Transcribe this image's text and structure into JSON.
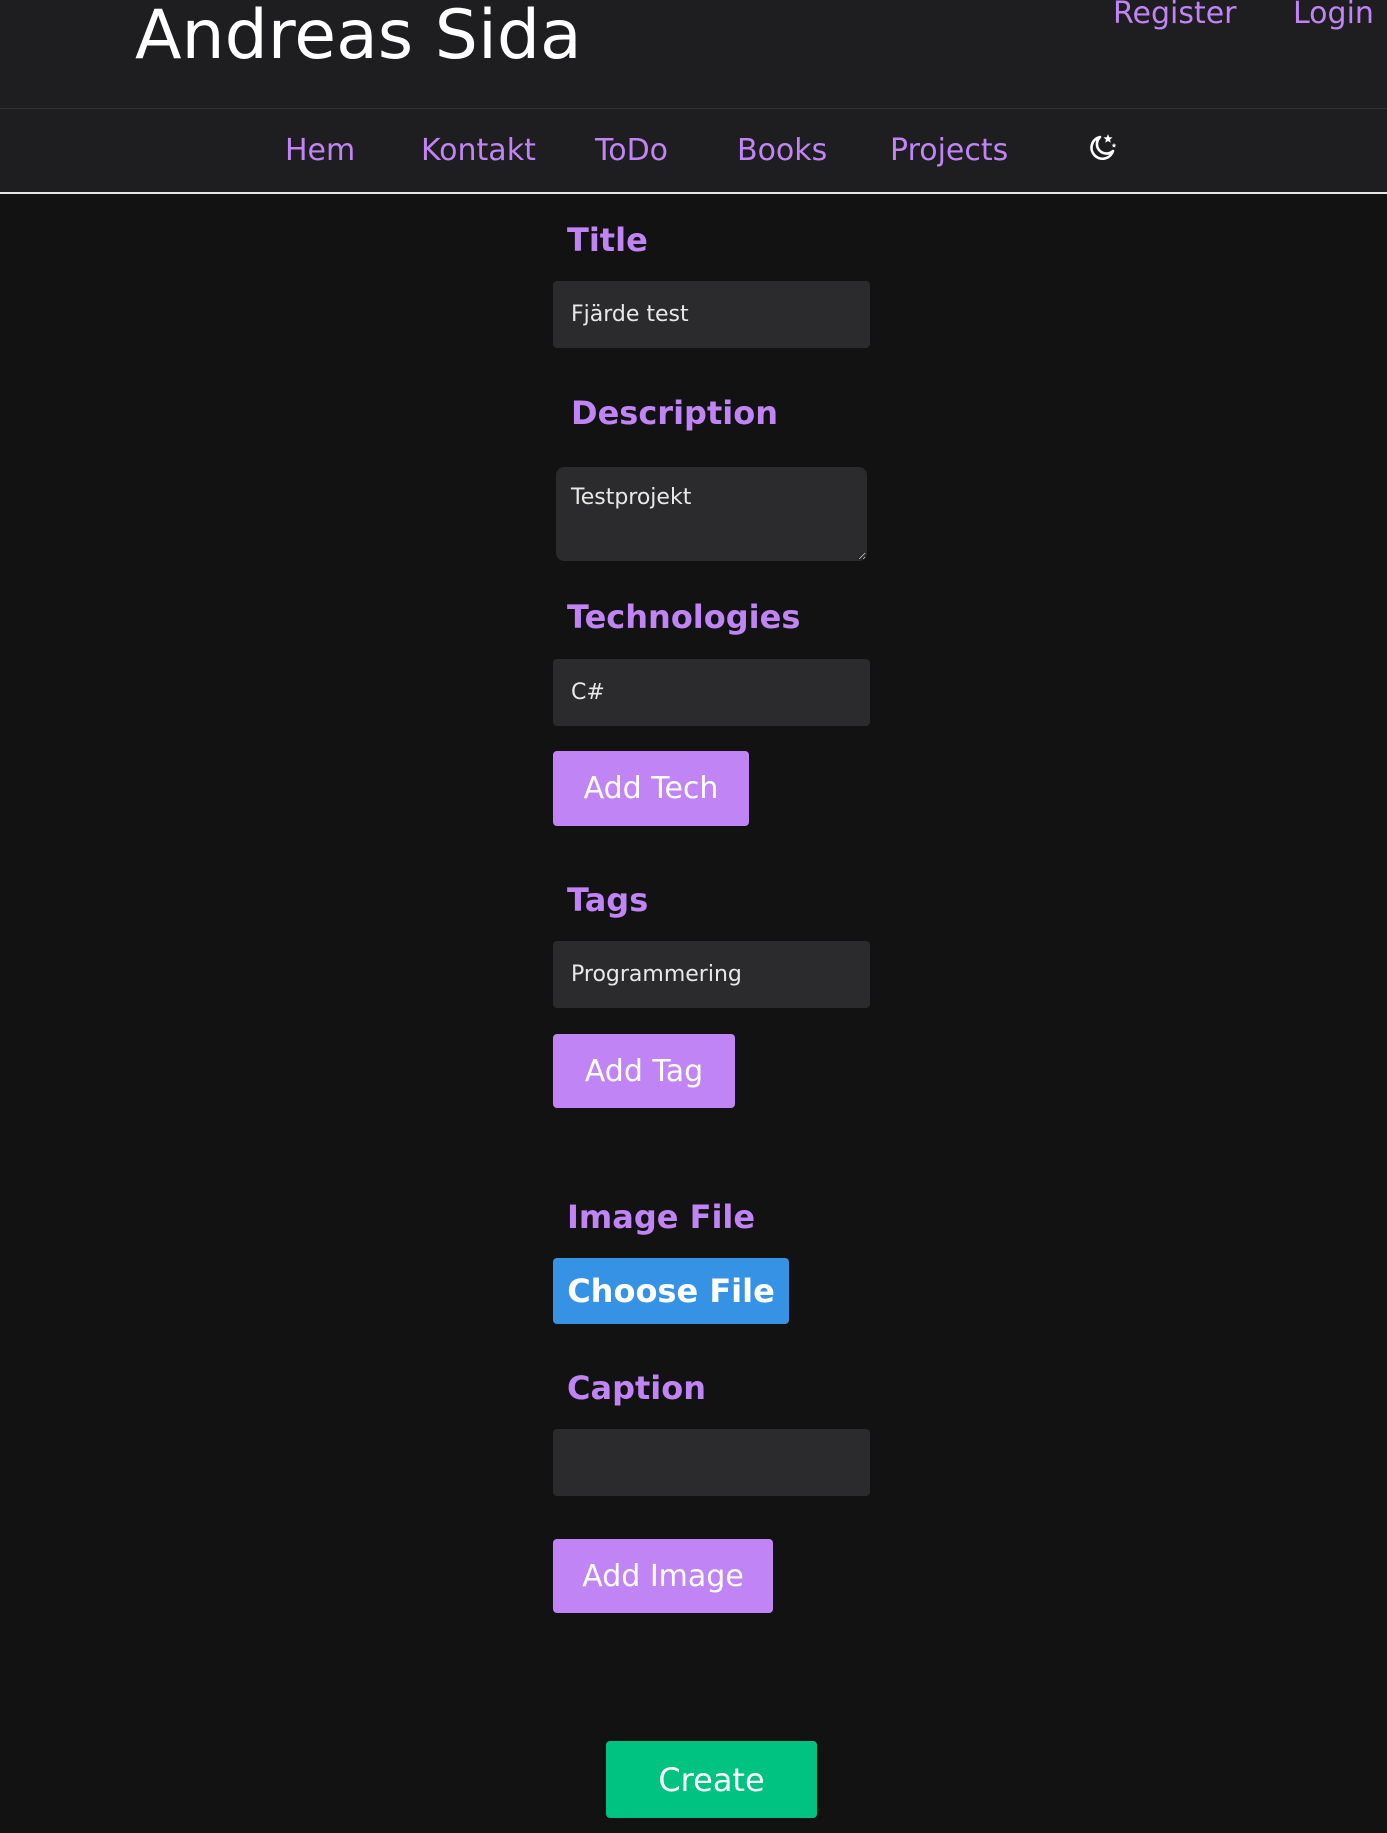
{
  "header": {
    "site_title": "Andreas Sida",
    "register_label": "Register",
    "login_label": "Login"
  },
  "nav": {
    "items": [
      {
        "label": "Hem"
      },
      {
        "label": "Kontakt"
      },
      {
        "label": "ToDo"
      },
      {
        "label": "Books"
      },
      {
        "label": "Projects"
      }
    ],
    "theme_icon": "moon-stars-icon"
  },
  "form": {
    "title": {
      "label": "Title",
      "value": "Fjärde test"
    },
    "description": {
      "label": "Description",
      "value": "Testprojekt"
    },
    "technologies": {
      "label": "Technologies",
      "value": "C#",
      "add_label": "Add Tech"
    },
    "tags": {
      "label": "Tags",
      "value": "Programmering",
      "add_label": "Add Tag"
    },
    "image_file": {
      "label": "Image File",
      "button_label": "Choose File"
    },
    "caption": {
      "label": "Caption",
      "value": "",
      "add_label": "Add Image"
    },
    "create_label": "Create"
  },
  "colors": {
    "accent": "#c084f5",
    "file_button": "#3592e4",
    "create_button": "#00c281",
    "background": "#121212",
    "header_background": "#1e1d1f",
    "input_background": "#2b2b2d"
  }
}
